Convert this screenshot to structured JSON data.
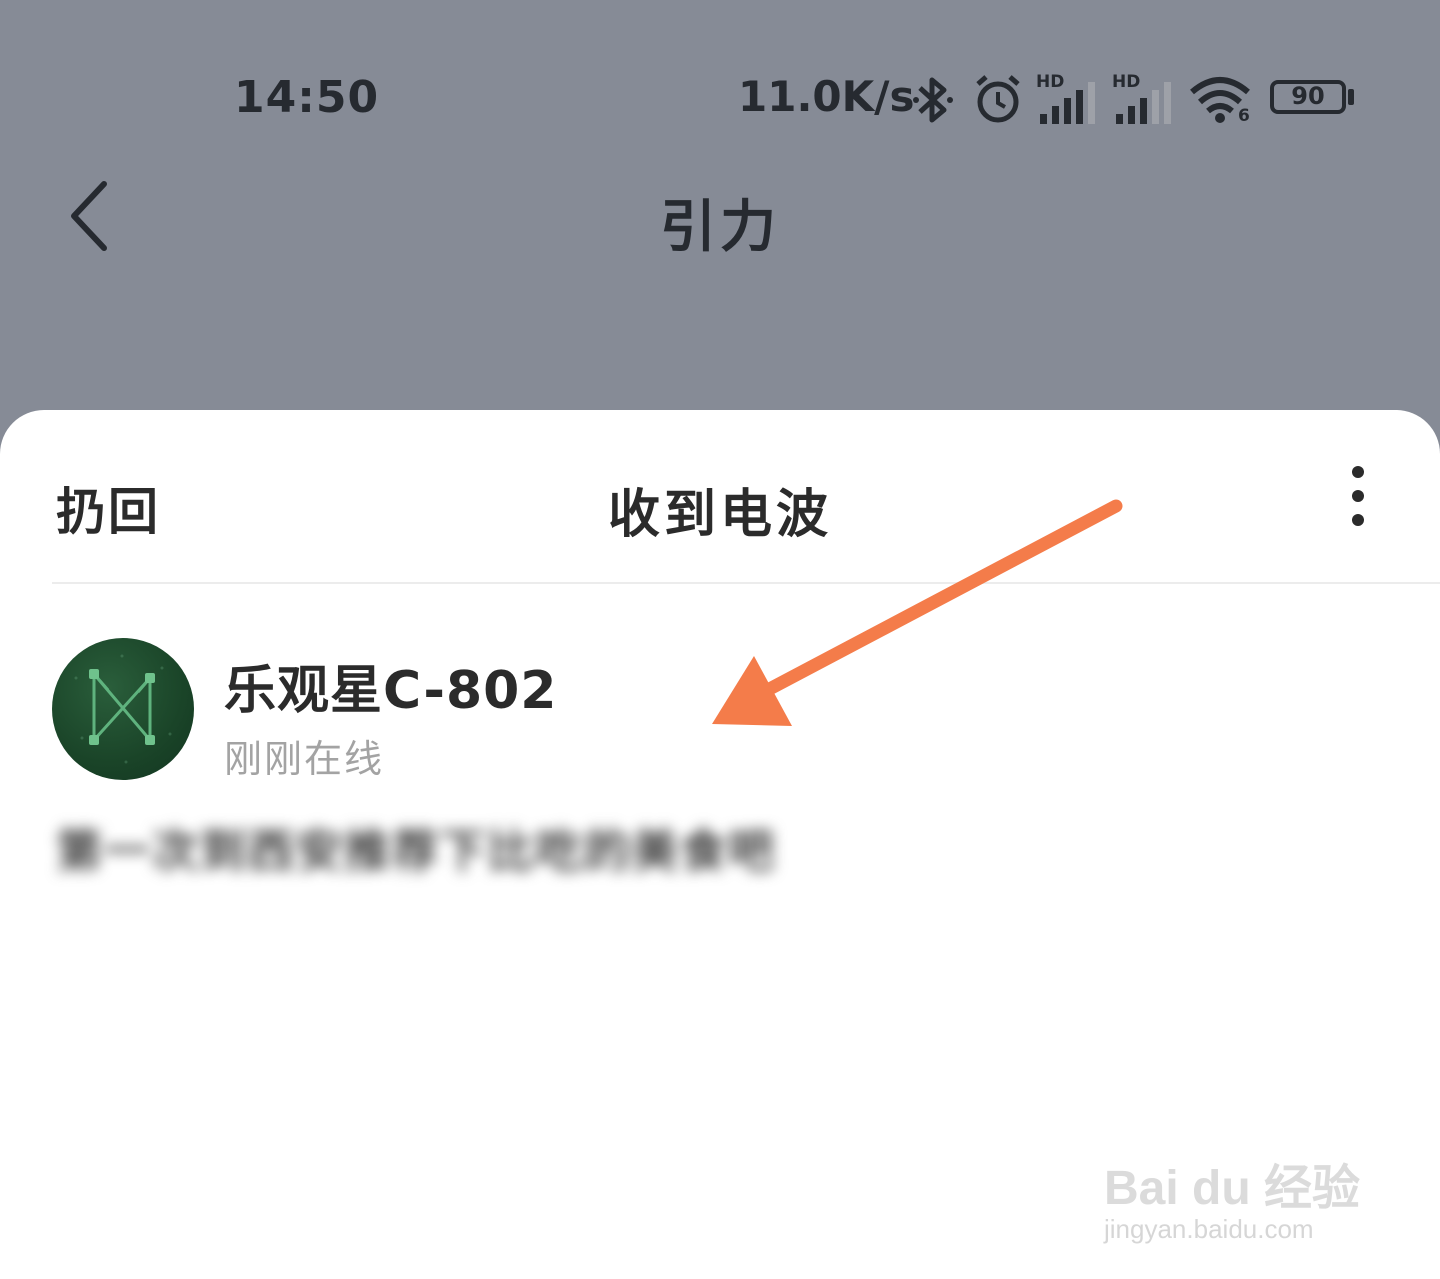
{
  "status_bar": {
    "time": "14:50",
    "net_speed": "11.0K/s",
    "signal_label_1": "HD",
    "signal_label_2": "HD",
    "wifi_label": "6",
    "battery": "90",
    "icons": [
      "bluetooth-icon",
      "alarm-icon",
      "signal-icon",
      "signal-icon",
      "wifi-icon",
      "battery-icon"
    ]
  },
  "nav": {
    "title": "引力",
    "back_icon": "chevron-left-icon"
  },
  "sheet": {
    "left_action": "扔回",
    "title": "收到电波",
    "more_icon": "more-vertical-icon"
  },
  "wave": {
    "sender_name": "乐观星C-802",
    "sender_status": "刚刚在线",
    "message": "第一次到西安推荐下比吃的美食吧"
  },
  "watermark": {
    "brand": "Bai du 经验",
    "url": "jingyan.baidu.com"
  },
  "colors": {
    "background_dim": "#868b96",
    "sheet": "#ffffff",
    "annotation_arrow": "#f47c4a",
    "avatar_green": "#1a4428"
  }
}
